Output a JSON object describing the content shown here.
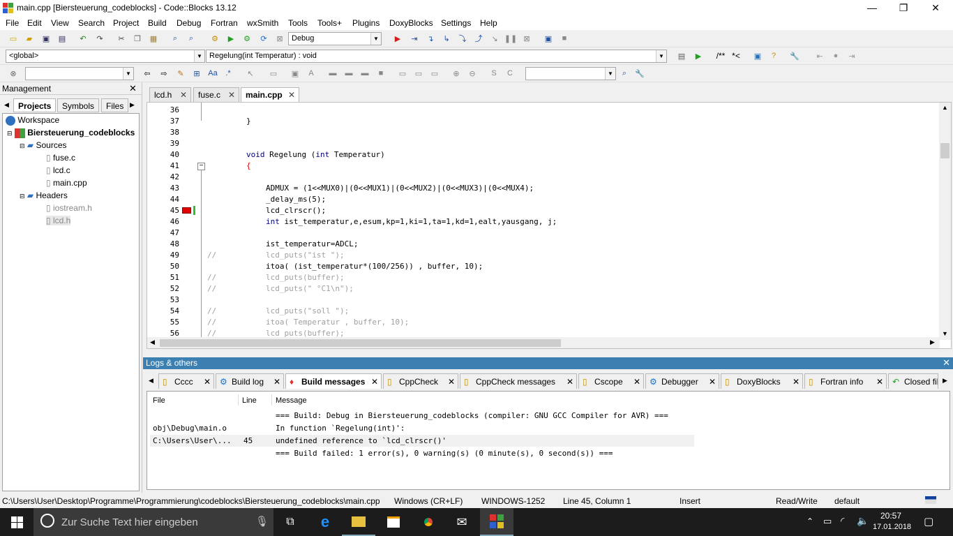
{
  "window": {
    "title": "main.cpp [Biersteuerung_codeblocks] - Code::Blocks 13.12"
  },
  "menu": [
    "File",
    "Edit",
    "View",
    "Search",
    "Project",
    "Build",
    "Debug",
    "Fortran",
    "wxSmith",
    "Tools",
    "Tools+",
    "Plugins",
    "DoxyBlocks",
    "Settings",
    "Help"
  ],
  "toolbar": {
    "build_target": "Debug",
    "scope": "<global>",
    "function": "Regelung(int Temperatur) : void",
    "doxy_comment1": "/**",
    "doxy_comment2": "*<"
  },
  "management": {
    "title": "Management",
    "tabs": [
      "Projects",
      "Symbols",
      "Files"
    ],
    "tree": {
      "workspace": "Workspace",
      "project": "Biersteuerung_codeblocks",
      "sources": "Sources",
      "source_files": [
        "fuse.c",
        "lcd.c",
        "main.cpp"
      ],
      "headers": "Headers",
      "header_files": [
        "iostream.h",
        "lcd.h"
      ]
    }
  },
  "editor": {
    "tabs": [
      "lcd.h",
      "fuse.c",
      "main.cpp"
    ],
    "active_tab": "main.cpp",
    "line_numbers": [
      "36",
      "37",
      "38",
      "39",
      "40",
      "41",
      "42",
      "43",
      "44",
      "45",
      "46",
      "47",
      "48",
      "49",
      "50",
      "51",
      "52",
      "53",
      "54",
      "55",
      "56"
    ],
    "lines": {
      "l37": "}",
      "l40_kw": "void",
      "l40_rest": " Regelung (",
      "l40_int": "int",
      "l40_end": " Temperatur)",
      "l41": "{",
      "l43": "ADMUX = (1<<MUX0)|(0<<MUX1)|(0<<MUX2)|(0<<MUX3)|(0<<MUX4);",
      "l44": "_delay_ms(5);",
      "l45": "lcd_clrscr();",
      "l46_kw": "int",
      "l46_rest": " ist_temperatur,e,esum,kp=1,ki=1,ta=1,kd=1,ealt,yausgang, j;",
      "l48": "ist_temperatur=ADCL;",
      "l49_c": "//",
      "l49": "lcd_puts(\"ist \");",
      "l50": "itoa( (ist_temperatur*(100/256)) , buffer, 10);",
      "l51_c": "//",
      "l51": "lcd_puts(buffer);",
      "l52_c": "//",
      "l52": "lcd_puts(\" °C1\\n\");",
      "l54_c": "//",
      "l54": "lcd_puts(\"soll \");",
      "l55_c": "//",
      "l55": "itoa( Temperatur , buffer, 10);",
      "l56_c": "//",
      "l56": "lcd_puts(buffer);"
    }
  },
  "logs": {
    "title": "Logs & others",
    "tabs": [
      "Cccc",
      "Build log",
      "Build messages",
      "CppCheck",
      "CppCheck messages",
      "Cscope",
      "Debugger",
      "DoxyBlocks",
      "Fortran info",
      "Closed files"
    ],
    "active_tab": "Build messages",
    "columns": [
      "File",
      "Line",
      "Message"
    ],
    "rows": [
      {
        "file": "",
        "line": "",
        "message": "=== Build: Debug in Biersteuerung_codeblocks (compiler: GNU GCC Compiler for AVR) ==="
      },
      {
        "file": "obj\\Debug\\main.o",
        "line": "",
        "message": "In function `Regelung(int)':"
      },
      {
        "file": "C:\\Users\\User\\...",
        "line": "45",
        "message": "undefined reference to `lcd_clrscr()'"
      },
      {
        "file": "",
        "line": "",
        "message": "=== Build failed: 1 error(s), 0 warning(s) (0 minute(s), 0 second(s)) ==="
      }
    ]
  },
  "status": {
    "path": "C:\\Users\\User\\Desktop\\Programme\\Programmierung\\codeblocks\\Biersteuerung_codeblocks\\main.cpp",
    "eol": "Windows (CR+LF)",
    "encoding": "WINDOWS-1252",
    "position": "Line 45, Column 1",
    "mode": "Insert",
    "access": "Read/Write",
    "profile": "default"
  },
  "taskbar": {
    "search_placeholder": "Zur Suche Text hier eingeben",
    "time": "20:57",
    "date": "17.01.2018"
  },
  "colors": {
    "accent": "#3c7fb1",
    "taskbar": "#1c1c1c",
    "breakpoint": "#e00000"
  }
}
